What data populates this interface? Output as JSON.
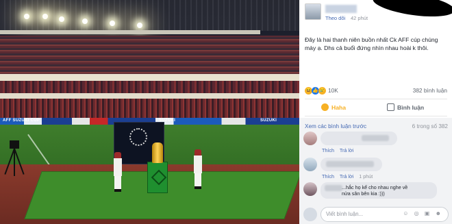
{
  "post": {
    "follow_label": "Theo dõi",
    "time": "42 phút",
    "text": "Đây là hai thanh niên buồn nhất Ck AFF cúp chúng mày ạ. Dhs cả buổi đứng nhìn nhau hoài k thôi.",
    "reactions_count": "10K",
    "comments_count": "382 bình luận",
    "reaction_icons": [
      "haha-icon",
      "like-icon",
      "sad-icon"
    ]
  },
  "actions": {
    "haha_label": "Haha",
    "comment_label": "Bình luận"
  },
  "comments": {
    "more_label": "Xem các bình luận trước",
    "count_label": "6 trong số 382",
    "items": [
      {
        "like": "Thích",
        "reply": "Trả lời",
        "time": ""
      },
      {
        "like": "Thích",
        "reply": "Trả lời",
        "time": "1 phút"
      },
      {
        "text": "...hắc họ kể cho nhau nghe về\nnửa sân bên kia :)))"
      }
    ],
    "write_placeholder": "Viết bình luận...",
    "write_icons": "☺ ◎ ▣ ☻"
  },
  "photo": {
    "board_texts": [
      "AFF SUZUKI CUP",
      "SUZUKI",
      "SUZUKI"
    ]
  },
  "colors": {
    "link": "#4267b2",
    "haha": "#f7b125",
    "like": "#1877f2"
  }
}
